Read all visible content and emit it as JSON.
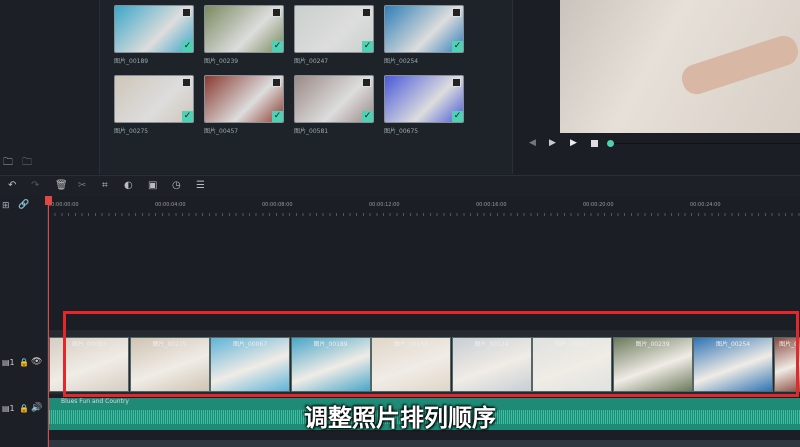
{
  "media": [
    {
      "name": "图片_00189",
      "color": "#3aa7c9"
    },
    {
      "name": "图片_00239",
      "color": "#7a8a60"
    },
    {
      "name": "图片_00247",
      "color": "#c9d0cc"
    },
    {
      "name": "图片_00254",
      "color": "#2e7fb8"
    },
    {
      "name": "图片_00275",
      "color": "#cfc5b9"
    },
    {
      "name": "图片_00457",
      "color": "#8a3a30"
    },
    {
      "name": "图片_00581",
      "color": "#9a8a86"
    },
    {
      "name": "图片_00675",
      "color": "#4a5ad8"
    }
  ],
  "ruler": [
    "00:00:00:00",
    "00:00:04:00",
    "00:00:08:00",
    "00:00:12:00",
    "00:00:16:00",
    "00:00:20:00",
    "00:00:24:00"
  ],
  "clips": [
    {
      "name": "图片_00093",
      "color": "#d6cdc2"
    },
    {
      "name": "图片_00275",
      "color": "#cfc3b3"
    },
    {
      "name": "图片_00067",
      "color": "#5fb3d8"
    },
    {
      "name": "图片_00189",
      "color": "#48a6c8"
    },
    {
      "name": "图片_00153",
      "color": "#e0d6c8"
    },
    {
      "name": "图片_00124",
      "color": "#c8ced4"
    },
    {
      "name": "图片_00247",
      "color": "#dfe2df"
    },
    {
      "name": "图片_00239",
      "color": "#6c7a5c"
    },
    {
      "name": "图片_00254",
      "color": "#2f74b4"
    },
    {
      "name": "图片_0",
      "color": "#8a4a40"
    }
  ],
  "audio_label": "Blues Fun and Country",
  "subtitle": "调整照片排列顺序"
}
